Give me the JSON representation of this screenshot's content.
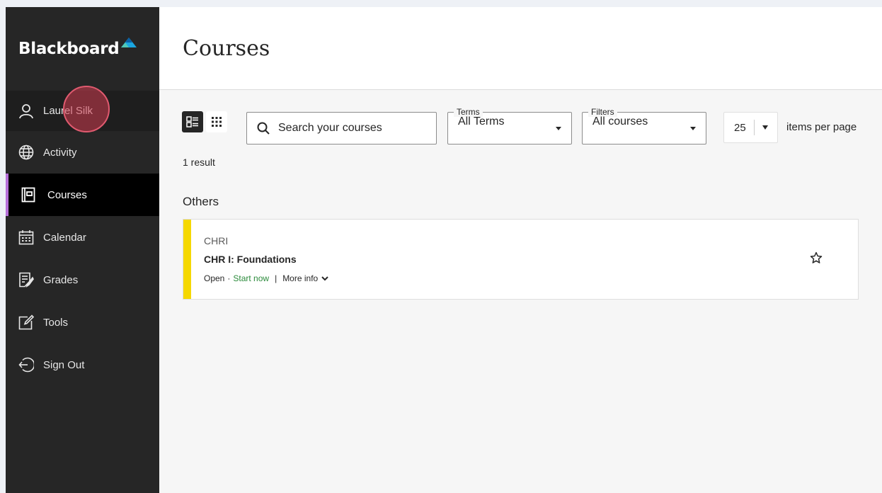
{
  "brand": {
    "name": "Blackboard",
    "accent": "#1aa6e0"
  },
  "sidebar": {
    "profile": {
      "name": "Laurel Silk",
      "icon": "user-icon"
    },
    "items": [
      {
        "label": "Activity",
        "icon": "globe-icon"
      },
      {
        "label": "Courses",
        "icon": "courses-icon",
        "active": true
      },
      {
        "label": "Calendar",
        "icon": "calendar-icon"
      },
      {
        "label": "Grades",
        "icon": "grades-icon"
      },
      {
        "label": "Tools",
        "icon": "tools-icon"
      },
      {
        "label": "Sign Out",
        "icon": "sign-out-icon"
      }
    ]
  },
  "header": {
    "title": "Courses"
  },
  "toolbar": {
    "search_placeholder": "Search your courses",
    "terms": {
      "legend": "Terms",
      "value": "All Terms"
    },
    "filters": {
      "legend": "Filters",
      "value": "All courses"
    },
    "per_page": {
      "value": "25",
      "label": "items per page"
    }
  },
  "results": {
    "count_text": "1 result",
    "section": "Others"
  },
  "course": {
    "code": "CHRI",
    "name": "CHR I: Foundations",
    "status": "Open",
    "separator": "·",
    "start_label": "Start now",
    "divider": "|",
    "more_info_label": "More info"
  },
  "colors": {
    "sidebar_bg": "#262626",
    "active_accent": "#b66fd8",
    "course_accent": "#f5d800",
    "link_green": "#2a8a3a"
  }
}
